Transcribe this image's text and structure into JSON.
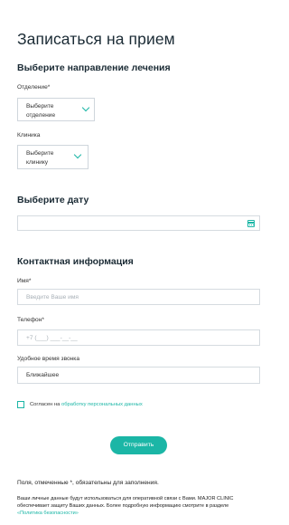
{
  "page_title": "Записаться на прием",
  "direction": {
    "title": "Выберите направление лечения",
    "department_label": "Отделение*",
    "department_value": "Выберите отделение",
    "clinic_label": "Клиника",
    "clinic_value": "Выберите клинику"
  },
  "date": {
    "title": "Выберите дату",
    "value": "",
    "icon": "calendar-icon"
  },
  "contact": {
    "title": "Контактная информация",
    "name_label": "Имя*",
    "name_placeholder": "Введите Ваше имя",
    "phone_label": "Телефон*",
    "phone_placeholder": "+7 (___) ___-__-__",
    "call_time_label": "Удобное время звонка",
    "call_time_value": "Ближайшее"
  },
  "consent": {
    "text": "Согласен на ",
    "link": "обработку персональных данных",
    "checked": false
  },
  "submit_label": "Отправить",
  "required_note": "Поля, отмеченные *, обязательны для заполнения.",
  "privacy": {
    "text": "Ваши личные данные будут использоваться для оперативной связи с Вами. MAJOR CLINIC обеспечивает защиту Ваших данных. Более подробную информацию смотрите в разделе ",
    "link": "«Политика безопасности»"
  },
  "colors": {
    "accent": "#1bb6a6",
    "heading": "#1b2b35",
    "border": "#cfd6dc"
  }
}
